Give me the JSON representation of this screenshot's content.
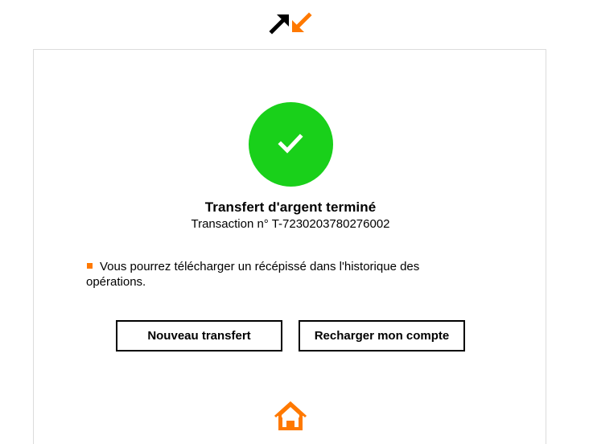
{
  "brand": {
    "logo_icon": "transfer-arrows-icon",
    "accent_color": "#ff7900",
    "dark_color": "#000000"
  },
  "status": {
    "icon": "checkmark-icon",
    "circle_color": "#19d01a"
  },
  "confirmation": {
    "title": "Transfert d'argent terminé",
    "transaction": "Transaction n° T-7230203780276002"
  },
  "notice": {
    "text": "Vous pourrez télécharger un récépissé dans l'historique des opérations."
  },
  "actions": {
    "new_transfer_label": "Nouveau transfert",
    "recharge_label": "Recharger mon compte"
  },
  "footer": {
    "home_icon": "home-icon"
  }
}
